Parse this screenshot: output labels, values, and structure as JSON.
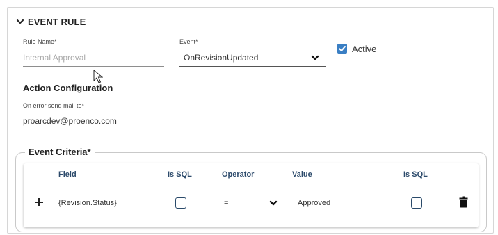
{
  "header": {
    "title": "EVENT RULE",
    "icon": "chevron-down-icon"
  },
  "rule_name": {
    "label": "Rule Name*",
    "placeholder": "Internal Approval",
    "value": ""
  },
  "event": {
    "label": "Event*",
    "value": "OnRevisionUpdated",
    "icon": "chevron-down-icon"
  },
  "active": {
    "label": "Active",
    "checked": true
  },
  "action_configuration": {
    "title": "Action Configuration",
    "mail_label": "On error send mail to*",
    "mail_value": "proarcdev@proenco.com"
  },
  "criteria": {
    "legend": "Event Criteria*",
    "columns": {
      "field": "Field",
      "is_sql_1": "Is SQL",
      "operator": "Operator",
      "value": "Value",
      "is_sql_2": "Is SQL"
    },
    "row": {
      "add_icon": "plus-icon",
      "field": "{Revision.Status}",
      "is_sql_1": false,
      "operator": "=",
      "value": "Approved",
      "is_sql_2": false,
      "delete_icon": "trash-icon"
    }
  },
  "colors": {
    "accent": "#3a7fc4",
    "header_text": "#2c4a6b",
    "border": "#c9c9c9"
  }
}
